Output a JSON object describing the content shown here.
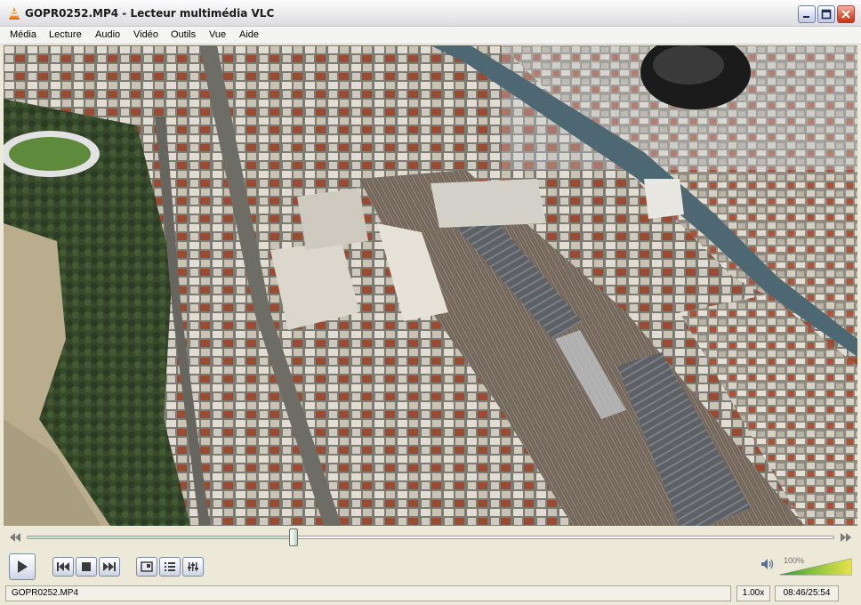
{
  "window": {
    "title": "GOPR0252.MP4 - Lecteur multimédia VLC",
    "app_icon": "vlc-cone-icon"
  },
  "menu": {
    "items": [
      "Média",
      "Lecture",
      "Audio",
      "Vidéo",
      "Outils",
      "Vue",
      "Aide"
    ]
  },
  "video": {
    "content": "aerial-city-view"
  },
  "seek": {
    "progress": 0.33
  },
  "controls": {
    "buttons": [
      "play-icon",
      "previous-icon",
      "stop-icon",
      "next-icon",
      "fullscreen-icon",
      "playlist-icon",
      "extended-settings-icon"
    ]
  },
  "volume": {
    "label": "100%",
    "level": 1.0
  },
  "status": {
    "filename": "GOPR0252.MP4",
    "speed": "1.00x",
    "time": "08:46/25:54"
  },
  "colors": {
    "accent": "#1f6fd0",
    "volume_low": "#2f9a2f",
    "volume_high": "#e6e14a"
  }
}
